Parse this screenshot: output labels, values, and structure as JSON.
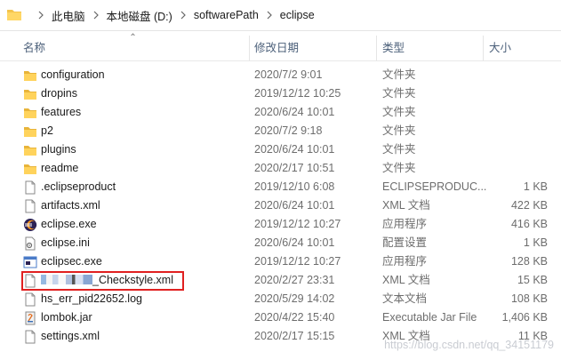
{
  "breadcrumb": [
    "此电脑",
    "本地磁盘 (D:)",
    "softwarePath",
    "eclipse"
  ],
  "columns": {
    "name": "名称",
    "date": "修改日期",
    "type": "类型",
    "size": "大小"
  },
  "files": [
    {
      "name": "configuration",
      "date": "2020/7/2 9:01",
      "type": "文件夹",
      "size": "",
      "icon": "folder"
    },
    {
      "name": "dropins",
      "date": "2019/12/12 10:25",
      "type": "文件夹",
      "size": "",
      "icon": "folder"
    },
    {
      "name": "features",
      "date": "2020/6/24 10:01",
      "type": "文件夹",
      "size": "",
      "icon": "folder"
    },
    {
      "name": "p2",
      "date": "2020/7/2 9:18",
      "type": "文件夹",
      "size": "",
      "icon": "folder"
    },
    {
      "name": "plugins",
      "date": "2020/6/24 10:01",
      "type": "文件夹",
      "size": "",
      "icon": "folder"
    },
    {
      "name": "readme",
      "date": "2020/2/17 10:51",
      "type": "文件夹",
      "size": "",
      "icon": "folder"
    },
    {
      "name": ".eclipseproduct",
      "date": "2019/12/10 6:08",
      "type": "ECLIPSEPRODUC...",
      "size": "1 KB",
      "icon": "file"
    },
    {
      "name": "artifacts.xml",
      "date": "2020/6/24 10:01",
      "type": "XML 文档",
      "size": "422 KB",
      "icon": "file"
    },
    {
      "name": "eclipse.exe",
      "date": "2019/12/12 10:27",
      "type": "应用程序",
      "size": "416 KB",
      "icon": "eclipse"
    },
    {
      "name": "eclipse.ini",
      "date": "2020/6/24 10:01",
      "type": "配置设置",
      "size": "1 KB",
      "icon": "ini"
    },
    {
      "name": "eclipsec.exe",
      "date": "2019/12/12 10:27",
      "type": "应用程序",
      "size": "128 KB",
      "icon": "exe"
    },
    {
      "name": "_Checkstyle.xml",
      "date": "2020/2/27 23:31",
      "type": "XML 文档",
      "size": "15 KB",
      "icon": "file",
      "redacted": true
    },
    {
      "name": "hs_err_pid22652.log",
      "date": "2020/5/29 14:02",
      "type": "文本文档",
      "size": "108 KB",
      "icon": "file"
    },
    {
      "name": "lombok.jar",
      "date": "2020/4/22 15:40",
      "type": "Executable Jar File",
      "size": "1,406 KB",
      "icon": "jar"
    },
    {
      "name": "settings.xml",
      "date": "2020/2/17 15:15",
      "type": "XML 文档",
      "size": "11 KB",
      "icon": "file"
    }
  ],
  "watermark": "https://blog.csdn.net/qq_34151179"
}
